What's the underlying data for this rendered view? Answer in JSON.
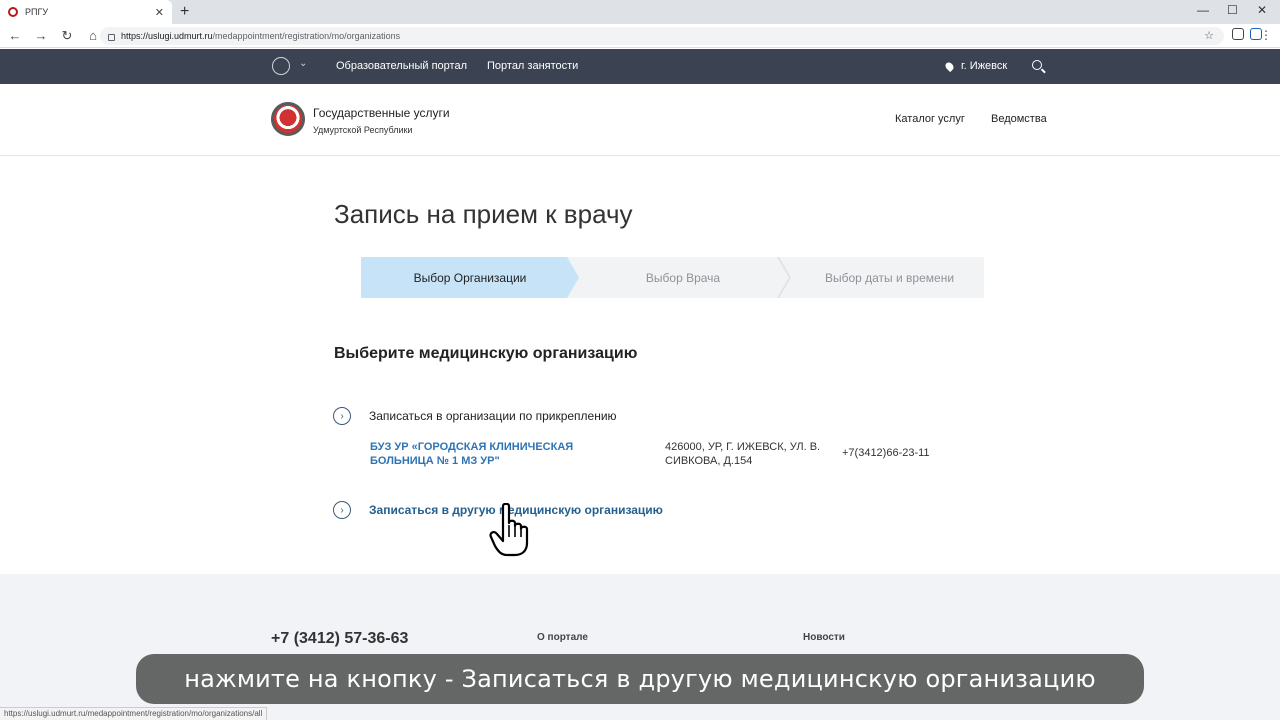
{
  "browser": {
    "tab_title": "РПГУ",
    "url_host": "https://uslugi.udmurt.ru",
    "url_path": "/medappointment/registration/mo/organizations",
    "status_url": "https://uslugi.udmurt.ru/medappointment/registration/mo/organizations/all"
  },
  "topnav": {
    "links": [
      "Образовательный портал",
      "Портал занятости"
    ],
    "city": "г. Ижевск"
  },
  "header": {
    "title": "Государственные услуги",
    "subtitle": "Удмуртской Республики",
    "links": [
      "Каталог услуг",
      "Ведомства"
    ]
  },
  "main": {
    "page_title": "Запись на прием к врачу",
    "steps": [
      "Выбор Организации",
      "Выбор Врача",
      "Выбор даты и времени"
    ],
    "active_step": 0,
    "section_title": "Выберите медицинскую организацию",
    "attached_option": "Записаться в организации по прикреплению",
    "organization": {
      "name": "БУЗ УР «ГОРОДСКАЯ КЛИНИЧЕСКАЯ БОЛЬНИЦА № 1 МЗ УР\"",
      "address": "426000, УР, Г. ИЖЕВСК, УЛ. В. СИВКОВА, Д.154",
      "phone": "+7(3412)66-23-11"
    },
    "other_option": "Записаться в другую медицинскую организацию"
  },
  "footer": {
    "phone": "+7 (3412) 57-36-63",
    "links": [
      "О портале",
      "Новости"
    ]
  },
  "caption": "нажмите на кнопку - Записаться в другую медицинскую организацию",
  "colors": {
    "topnav_bg": "#3b4352",
    "active_step": "#c6e3f7",
    "link_blue": "#2e74b5"
  }
}
